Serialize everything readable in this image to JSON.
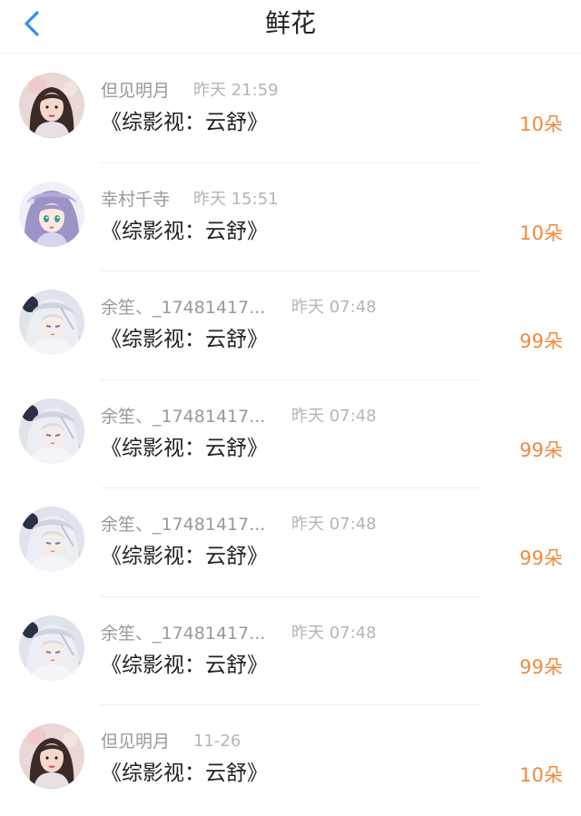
{
  "header": {
    "title": "鲜花",
    "back_icon": "chevron-left-icon"
  },
  "colors": {
    "accent": "#2e8ff0",
    "count": "#f08a3c",
    "name": "#999999",
    "time": "#b5b5b5"
  },
  "items": [
    {
      "name": "但见明月",
      "time": "昨天 21:59",
      "book": "《综影视：云舒》",
      "count": "10朵",
      "avatar": "avatar-girl-dark-hair"
    },
    {
      "name": "幸村千寺",
      "time": "昨天 15:51",
      "book": "《综影视：云舒》",
      "count": "10朵",
      "avatar": "avatar-anime-purple-hair"
    },
    {
      "name": "余笙、_17481417...",
      "time": "昨天 07:48",
      "book": "《综影视：云舒》",
      "count": "99朵",
      "avatar": "avatar-anime-silver-hair"
    },
    {
      "name": "余笙、_17481417...",
      "time": "昨天 07:48",
      "book": "《综影视：云舒》",
      "count": "99朵",
      "avatar": "avatar-anime-silver-hair"
    },
    {
      "name": "余笙、_17481417...",
      "time": "昨天 07:48",
      "book": "《综影视：云舒》",
      "count": "99朵",
      "avatar": "avatar-anime-silver-hair"
    },
    {
      "name": "余笙、_17481417...",
      "time": "昨天 07:48",
      "book": "《综影视：云舒》",
      "count": "99朵",
      "avatar": "avatar-anime-silver-hair"
    },
    {
      "name": "但见明月",
      "time": "11-26",
      "book": "《综影视：云舒》",
      "count": "10朵",
      "avatar": "avatar-girl-dark-hair"
    }
  ]
}
